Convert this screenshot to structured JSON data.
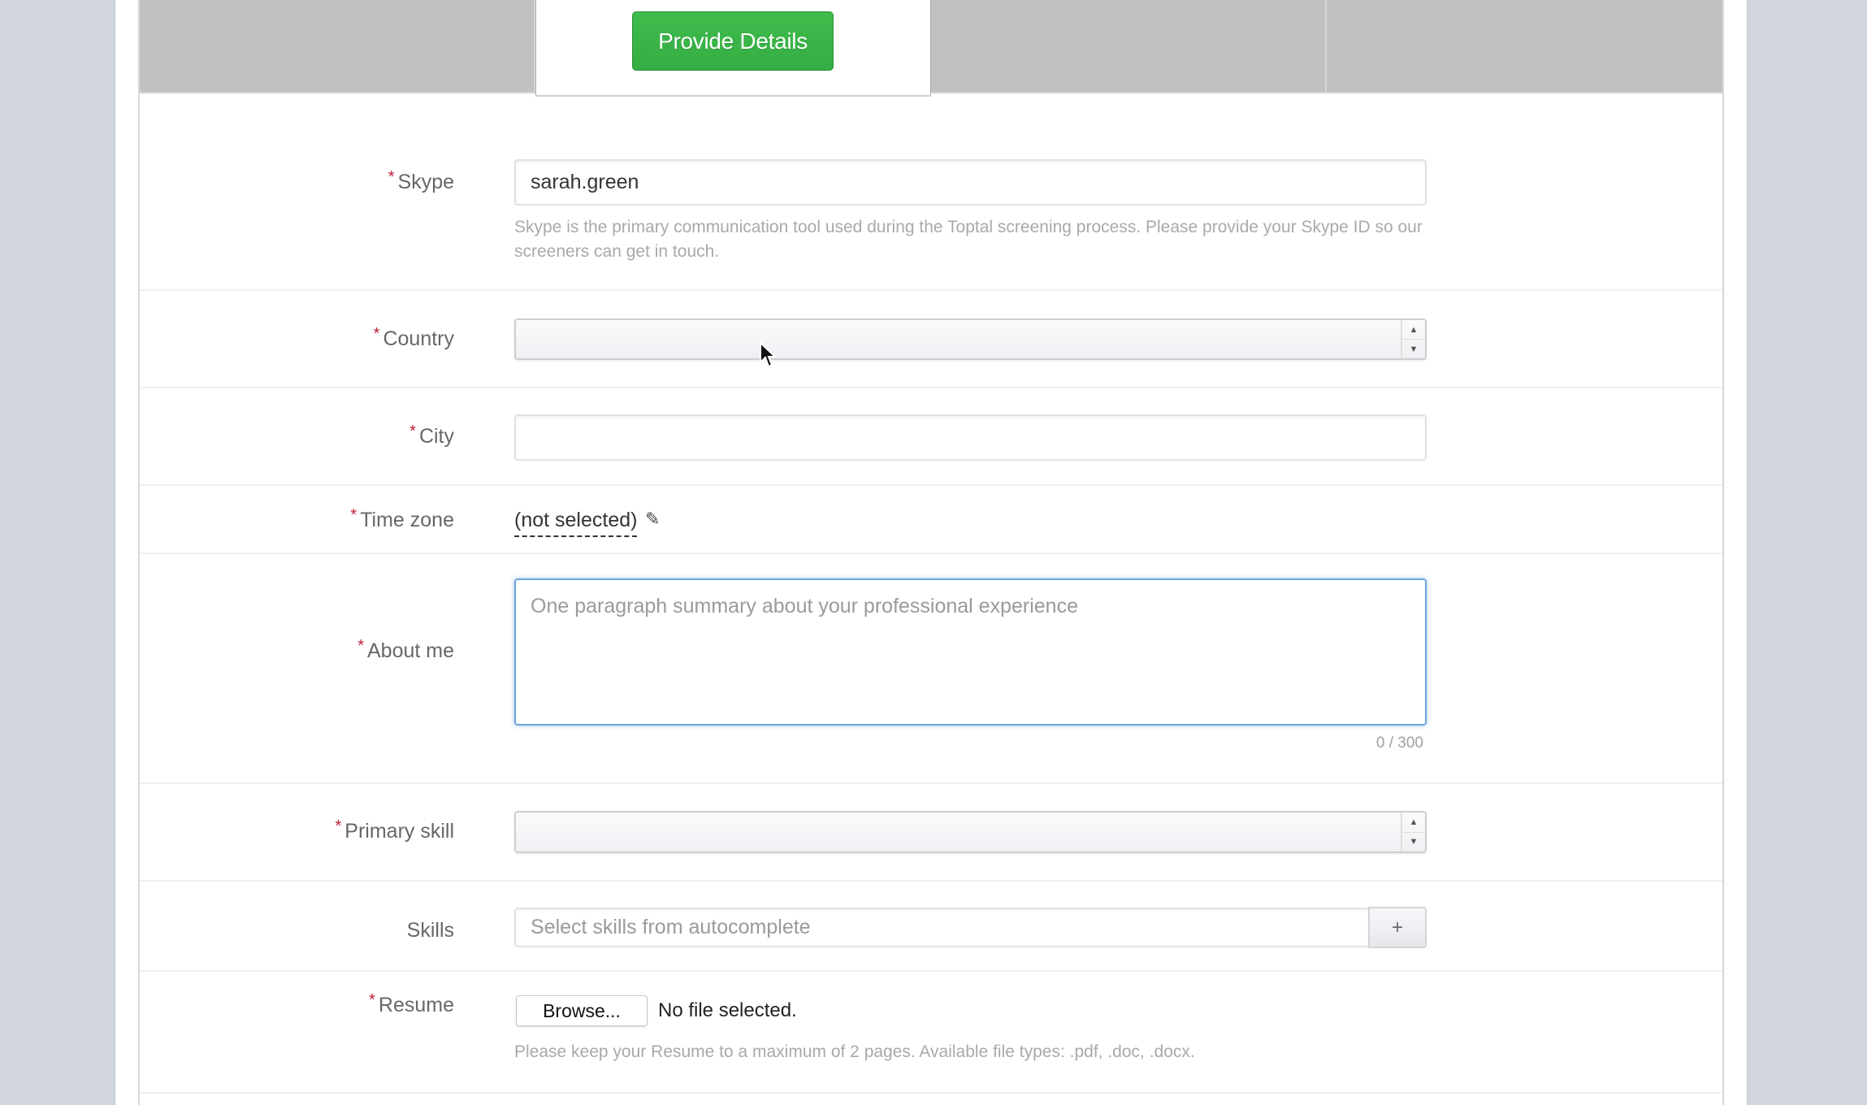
{
  "tabs": [
    {
      "label": ""
    },
    {
      "label": "Provide Details",
      "active": true
    },
    {
      "label": ""
    },
    {
      "label": ""
    }
  ],
  "colors": {
    "primary_green": "#3bb54a",
    "required_asterisk": "#c0203a",
    "focus_blue": "#6aa6dc"
  },
  "form": {
    "required_marker": "*",
    "skype": {
      "label": "Skype",
      "value": "sarah.green",
      "help": "Skype is the primary communication tool used during the Toptal screening process. Please provide your Skype ID so our screeners can get in touch."
    },
    "country": {
      "label": "Country",
      "value": ""
    },
    "city": {
      "label": "City",
      "value": ""
    },
    "time_zone": {
      "label": "Time zone",
      "value": "(not selected)",
      "edit_icon": "pencil-icon"
    },
    "about_me": {
      "label": "About me",
      "placeholder": "One paragraph summary about your professional experience",
      "counter": "0 / 300"
    },
    "primary_skill": {
      "label": "Primary skill",
      "value": ""
    },
    "skills": {
      "label": "Skills",
      "placeholder": "Select skills from autocomplete",
      "add_label": "+"
    },
    "resume": {
      "label": "Resume",
      "browse_label": "Browse...",
      "file_status": "No file selected.",
      "help": "Please keep your Resume to a maximum of 2 pages. Available file types: .pdf, .doc, .docx."
    }
  },
  "spinner": {
    "up": "▲",
    "down": "▼"
  },
  "icons": {
    "pencil": "✎"
  }
}
